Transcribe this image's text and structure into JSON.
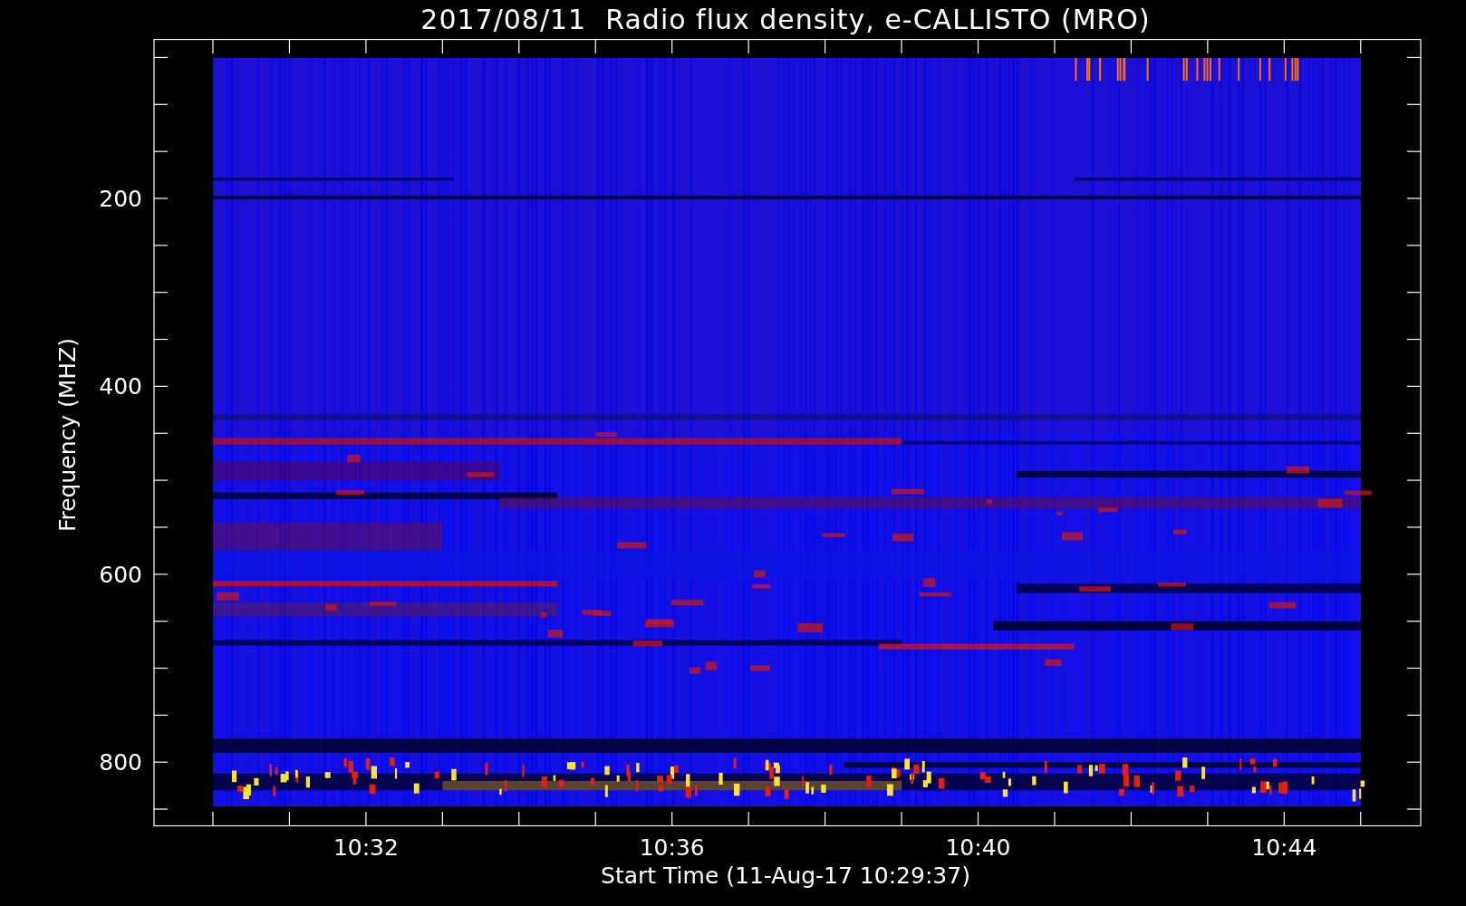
{
  "title": "2017/08/11  Radio flux density, e-CALLISTO (MRO)",
  "y_axis": {
    "label": "Frequency (MHZ)",
    "tick_labels": [
      "200",
      "400",
      "600",
      "800"
    ]
  },
  "x_axis": {
    "label": "Start Time (11-Aug-17 10:29:37)",
    "tick_labels": [
      "10:32",
      "10:36",
      "10:40",
      "10:44"
    ]
  }
}
